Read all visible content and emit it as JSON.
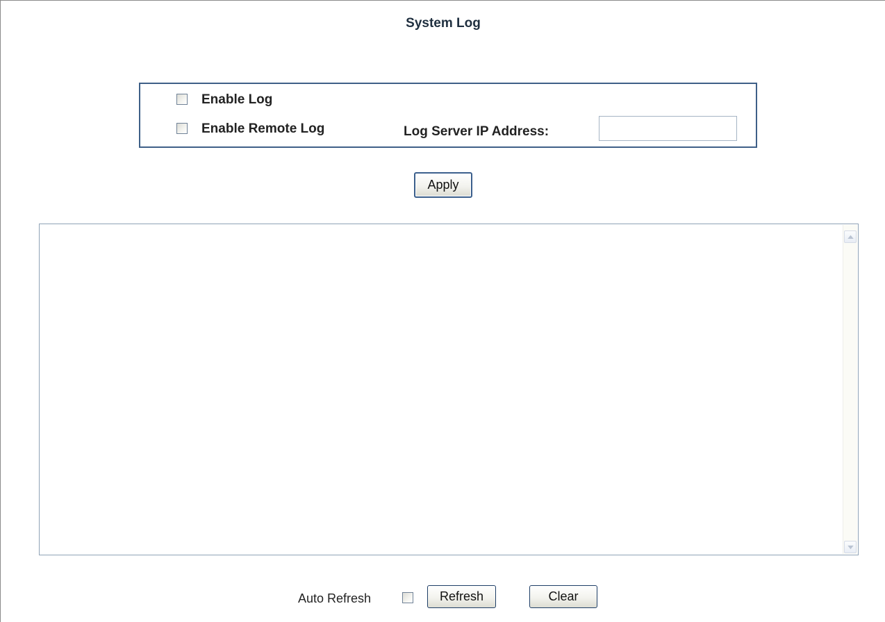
{
  "page": {
    "title": "System Log"
  },
  "settings": {
    "enable_log_label": "Enable Log",
    "enable_log_checked": false,
    "enable_remote_log_label": "Enable Remote Log",
    "enable_remote_log_checked": false,
    "log_server_ip_label": "Log Server IP Address:",
    "log_server_ip_value": ""
  },
  "actions": {
    "apply_label": "Apply"
  },
  "log": {
    "content": ""
  },
  "footer": {
    "auto_refresh_label": "Auto Refresh",
    "auto_refresh_checked": false,
    "refresh_label": "Refresh",
    "clear_label": "Clear"
  },
  "icons": {
    "scroll_up": "chevron-up-icon",
    "scroll_down": "chevron-down-icon"
  },
  "colors": {
    "frame_border": "#3e5f87",
    "button_border": "#1d3d66",
    "title_text": "#203040"
  }
}
